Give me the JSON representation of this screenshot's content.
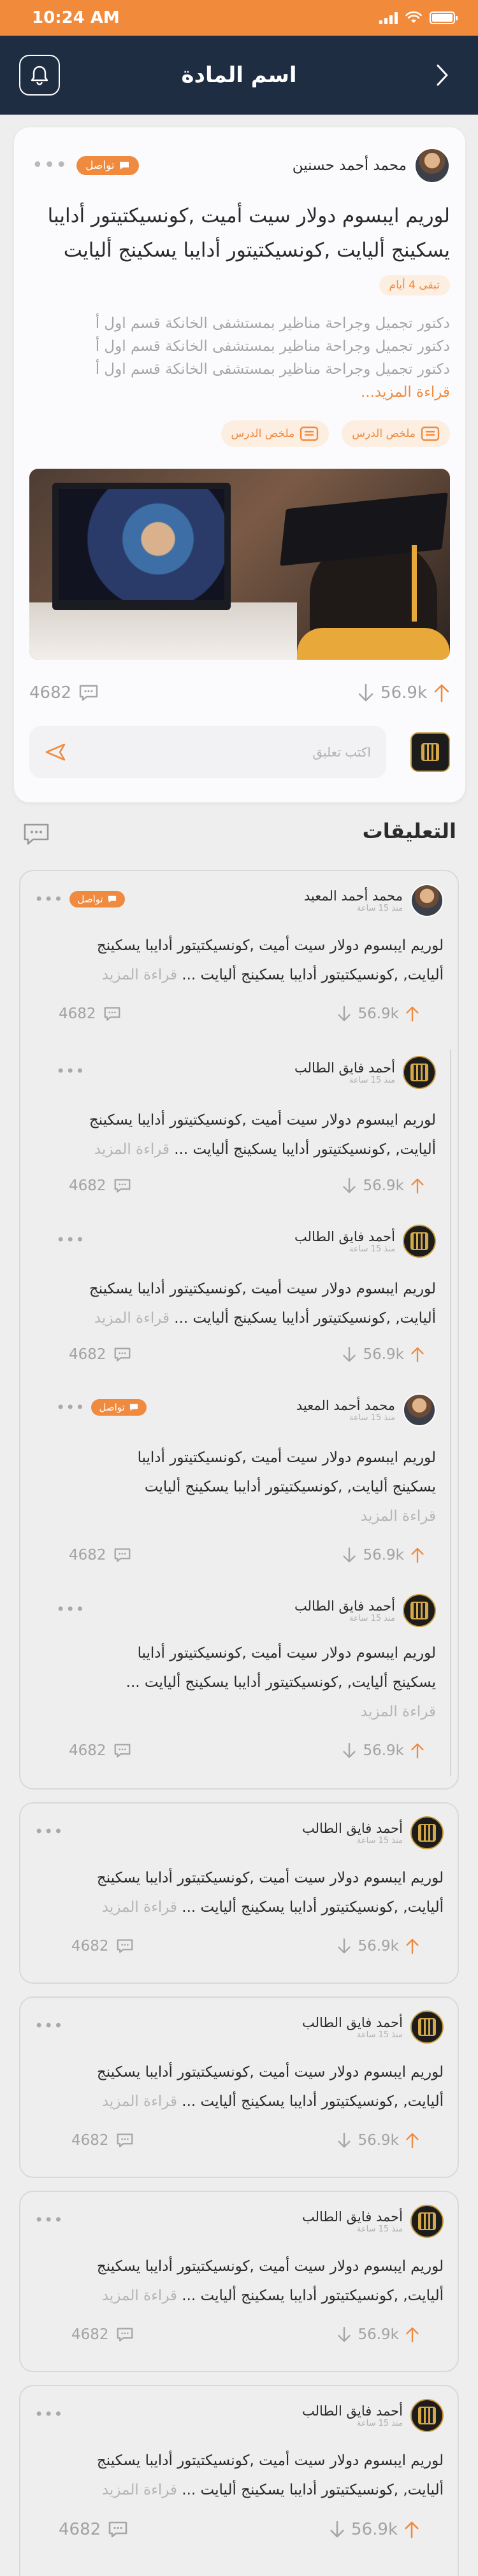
{
  "status": {
    "time": "10:24 AM"
  },
  "header": {
    "title": "اسم المادة"
  },
  "post": {
    "author": "محمد أحمد حسنين",
    "tag": "تواصل",
    "title": "لوريم ايبسوم دولار سيت أميت ,كونسيكتيتور أدايبا يسكينج أليايت ,كونسيكتيتور أدايبا يسكينج أليايت",
    "remaining": "تبقى 4 أيام",
    "description_lines": [
      "دكتور تجميل وجراحة مناظير بمستشفى الخانكة قسم اول أ",
      "دكتور تجميل وجراحة مناظير بمستشفى الخانكة قسم اول أ",
      "دكتور تجميل وجراحة مناظير بمستشفى الخانكة قسم اول أ"
    ],
    "read_more": "قراءة المزيد...",
    "attachments": [
      "ملخص الدرس",
      "ملخص الدرس"
    ],
    "votes": "56.9k",
    "comments_count": "4682",
    "comment_placeholder": "اكتب تعليق"
  },
  "comments_section": {
    "title": "التعليقات"
  },
  "comments": {
    "main": {
      "author": "محمد أحمد المعيد",
      "time": "منذ 15 ساعة",
      "tag": "تواصل",
      "text_line1": "لوريم ايبسوم دولار سيت أميت ,كونسيكتيتور أدايبا يسكينج",
      "text_line2": "أليايت, ,كونسيكتيتور أدايبا يسكينج أليايت ... ",
      "read_more": "قراءة المزيد",
      "votes": "56.9k",
      "count": "4682"
    },
    "reply1": {
      "author": "أحمد فايق الطالب",
      "time": "منذ 15 ساعة",
      "text_line1": "لوريم ايبسوم دولار سيت أميت ,كونسيكتيتور أدايبا يسكينج",
      "text_line2": "أليايت, ,كونسيكتيتور أدايبا يسكينج أليايت ... ",
      "read_more": "قراءة المزيد",
      "votes": "56.9k",
      "count": "4682"
    },
    "reply2": {
      "author": "أحمد فايق الطالب",
      "time": "منذ 15 ساعة",
      "text_line1": "لوريم ايبسوم دولار سيت أميت ,كونسيكتيتور أدايبا يسكينج",
      "text_line2": "أليايت, ,كونسيكتيتور أدايبا يسكينج أليايت ... ",
      "read_more": "قراءة المزيد",
      "votes": "56.9k",
      "count": "4682"
    },
    "reply3": {
      "author": "محمد أحمد المعيد",
      "time": "منذ 15 ساعة",
      "tag": "تواصل",
      "text_line1": "لوريم ايبسوم دولار سيت أميت ,كونسيكتيتور أدايبا",
      "text_line2": "يسكينج أليايت, ,كونسيكتيتور أدايبا يسكينج أليايت",
      "read_more": "قراءة المزيد",
      "votes": "56.9k",
      "count": "4682"
    },
    "reply4": {
      "author": "أحمد فايق الطالب",
      "time": "منذ 15 ساعة",
      "text_line1": "لوريم ايبسوم دولار سيت أميت ,كونسيكتيتور أدايبا",
      "text_line2": "يسكينج أليايت, ,كونسيكتيتور أدايبا يسكينج أليايت ...",
      "read_more": "قراءة المزيد",
      "votes": "56.9k",
      "count": "4682"
    },
    "standalone": [
      {
        "author": "أحمد فايق الطالب",
        "time": "منذ 15 ساعة",
        "text_line1": "لوريم ايبسوم دولار سيت أميت ,كونسيكتيتور أدايبا يسكينج",
        "text_line2": "أليايت, ,كونسيكتيتور أدايبا يسكينج أليايت ... ",
        "read_more": "قراءة المزيد",
        "votes": "56.9k",
        "count": "4682"
      },
      {
        "author": "أحمد فايق الطالب",
        "time": "منذ 15 ساعة",
        "text_line1": "لوريم ايبسوم دولار سيت أميت ,كونسيكتيتور أدايبا يسكينج",
        "text_line2": "أليايت, ,كونسيكتيتور أدايبا يسكينج أليايت ... ",
        "read_more": "قراءة المزيد",
        "votes": "56.9k",
        "count": "4682"
      },
      {
        "author": "أحمد فايق الطالب",
        "time": "منذ 15 ساعة",
        "text_line1": "لوريم ايبسوم دولار سيت أميت ,كونسيكتيتور أدايبا يسكينج",
        "text_line2": "أليايت, ,كونسيكتيتور أدايبا يسكينج أليايت ... ",
        "read_more": "قراءة المزيد",
        "votes": "56.9k",
        "count": "4682"
      },
      {
        "author": "أحمد فايق الطالب",
        "time": "منذ 15 ساعة",
        "text_line1": "لوريم ايبسوم دولار سيت أميت ,كونسيكتيتور أدايبا يسكينج",
        "text_line2": "أليايت, ,كونسيكتيتور أدايبا يسكينج أليايت ... ",
        "read_more": "قراءة المزيد",
        "votes": "56.9k",
        "count": "4682"
      }
    ]
  },
  "colors": {
    "accent": "#f08a3e",
    "header": "#1f2d43",
    "statusbar": "#f28a3c"
  },
  "icons": [
    "bell-icon",
    "chevron-right-icon",
    "chat-bubble-icon",
    "arrow-up-icon",
    "arrow-down-icon",
    "send-icon",
    "document-icon",
    "comments-icon",
    "more-icon"
  ]
}
